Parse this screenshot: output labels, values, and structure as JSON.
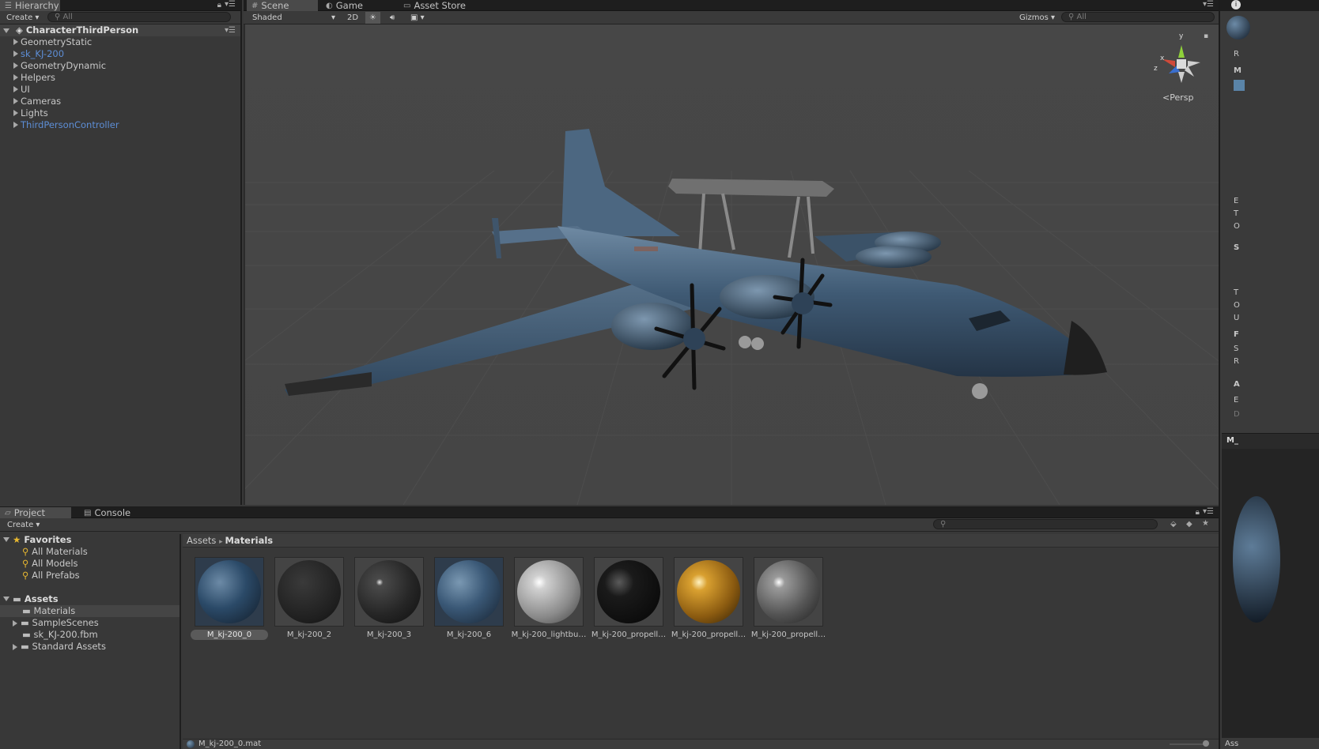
{
  "hierarchy": {
    "tab_label": "Hierarchy",
    "create_label": "Create",
    "search_placeholder": "All",
    "root": "CharacterThirdPerson",
    "items": [
      {
        "label": "GeometryStatic",
        "prefab": false
      },
      {
        "label": "sk_KJ-200",
        "prefab": true
      },
      {
        "label": "GeometryDynamic",
        "prefab": false
      },
      {
        "label": "Helpers",
        "prefab": false
      },
      {
        "label": "UI",
        "prefab": false
      },
      {
        "label": "Cameras",
        "prefab": false
      },
      {
        "label": "Lights",
        "prefab": false
      },
      {
        "label": "ThirdPersonController",
        "prefab": true
      }
    ]
  },
  "scene": {
    "tabs": [
      "Scene",
      "Game",
      "Asset Store"
    ],
    "shading_mode": "Shaded",
    "mode_2d": "2D",
    "gizmos_label": "Gizmos",
    "search_placeholder": "All",
    "projection": "Persp",
    "gizmo_axes": {
      "y": "y",
      "x": "x",
      "z": "z"
    }
  },
  "project": {
    "tabs": [
      "Project",
      "Console"
    ],
    "create_label": "Create",
    "favorites_label": "Favorites",
    "favorites": [
      "All Materials",
      "All Models",
      "All Prefabs"
    ],
    "assets_label": "Assets",
    "assets_children": [
      {
        "label": "Materials",
        "expandable": false
      },
      {
        "label": "SampleScenes",
        "expandable": true
      },
      {
        "label": "sk_KJ-200.fbm",
        "expandable": false
      },
      {
        "label": "Standard Assets",
        "expandable": true
      }
    ],
    "breadcrumb_root": "Assets",
    "breadcrumb_current": "Materials",
    "materials": [
      {
        "name": "M_kj-200_0",
        "style": "camo"
      },
      {
        "name": "M_kj-200_2",
        "style": "dark-matte"
      },
      {
        "name": "M_kj-200_3",
        "style": "dark-gloss"
      },
      {
        "name": "M_kj-200_6",
        "style": "camo"
      },
      {
        "name": "M_kj-200_lightbu…",
        "style": "white"
      },
      {
        "name": "M_kj-200_propell…",
        "style": "black"
      },
      {
        "name": "M_kj-200_propell…",
        "style": "gold"
      },
      {
        "name": "M_kj-200_propell…",
        "style": "grey"
      }
    ],
    "status_file": "M_kj-200_0.mat"
  },
  "inspector": {
    "fragments": [
      "R",
      "M",
      "E",
      "T",
      "O",
      "S",
      "T",
      "O",
      "U",
      "F",
      "S",
      "R",
      "A",
      "E",
      "D",
      "M_",
      "Ass"
    ]
  },
  "colors": {
    "prefab_blue": "#5d8ed6",
    "scene_bg": "#464646",
    "panel_bg": "#383838"
  }
}
